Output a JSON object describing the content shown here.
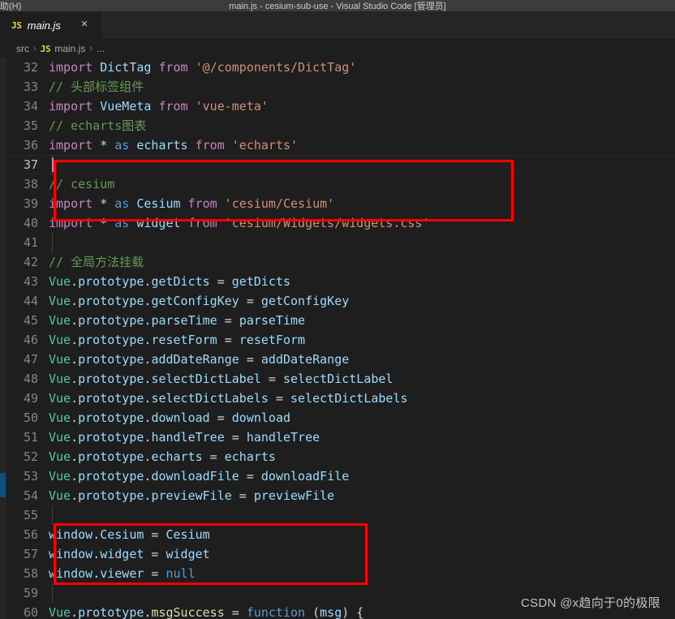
{
  "titlebar": {
    "menu_fragment": "助(H)",
    "window_title": "main.js - cesium-sub-use - Visual Studio Code [管理员]"
  },
  "tab": {
    "file_type_badge": "JS",
    "label": "main.js",
    "close_icon": "×"
  },
  "breadcrumb": {
    "folder": "src",
    "sep1": "›",
    "file_badge": "JS",
    "file": "main.js",
    "sep2": "›",
    "more": "..."
  },
  "editor": {
    "active_line": 37,
    "lines": [
      {
        "n": "32",
        "tokens": [
          {
            "t": "kw",
            "s": "import"
          },
          {
            "t": "op",
            "s": " "
          },
          {
            "t": "var",
            "s": "DictTag"
          },
          {
            "t": "op",
            "s": " "
          },
          {
            "t": "kw",
            "s": "from"
          },
          {
            "t": "op",
            "s": " "
          },
          {
            "t": "str",
            "s": "'@/components/DictTag'"
          }
        ]
      },
      {
        "n": "33",
        "tokens": [
          {
            "t": "cmt",
            "s": "// 头部标签组件"
          }
        ]
      },
      {
        "n": "34",
        "tokens": [
          {
            "t": "kw",
            "s": "import"
          },
          {
            "t": "op",
            "s": " "
          },
          {
            "t": "var",
            "s": "VueMeta"
          },
          {
            "t": "op",
            "s": " "
          },
          {
            "t": "kw",
            "s": "from"
          },
          {
            "t": "op",
            "s": " "
          },
          {
            "t": "str",
            "s": "'vue-meta'"
          }
        ]
      },
      {
        "n": "35",
        "tokens": [
          {
            "t": "cmt",
            "s": "// echarts图表"
          }
        ]
      },
      {
        "n": "36",
        "tokens": [
          {
            "t": "kw",
            "s": "import"
          },
          {
            "t": "op",
            "s": " "
          },
          {
            "t": "op",
            "s": "*"
          },
          {
            "t": "op",
            "s": " "
          },
          {
            "t": "ctrl",
            "s": "as"
          },
          {
            "t": "op",
            "s": " "
          },
          {
            "t": "var",
            "s": "echarts"
          },
          {
            "t": "op",
            "s": " "
          },
          {
            "t": "kw",
            "s": "from"
          },
          {
            "t": "op",
            "s": " "
          },
          {
            "t": "str",
            "s": "'echarts'"
          }
        ]
      },
      {
        "n": "37",
        "tokens": []
      },
      {
        "n": "38",
        "tokens": [
          {
            "t": "cmt",
            "s": "// cesium"
          }
        ]
      },
      {
        "n": "39",
        "tokens": [
          {
            "t": "kw",
            "s": "import"
          },
          {
            "t": "op",
            "s": " "
          },
          {
            "t": "op",
            "s": "*"
          },
          {
            "t": "op",
            "s": " "
          },
          {
            "t": "ctrl",
            "s": "as"
          },
          {
            "t": "op",
            "s": " "
          },
          {
            "t": "var",
            "s": "Cesium"
          },
          {
            "t": "op",
            "s": " "
          },
          {
            "t": "kw",
            "s": "from"
          },
          {
            "t": "op",
            "s": " "
          },
          {
            "t": "str",
            "s": "'cesium/Cesium'"
          }
        ]
      },
      {
        "n": "40",
        "tokens": [
          {
            "t": "kw",
            "s": "import"
          },
          {
            "t": "op",
            "s": " "
          },
          {
            "t": "op",
            "s": "*"
          },
          {
            "t": "op",
            "s": " "
          },
          {
            "t": "ctrl",
            "s": "as"
          },
          {
            "t": "op",
            "s": " "
          },
          {
            "t": "var",
            "s": "widget"
          },
          {
            "t": "op",
            "s": " "
          },
          {
            "t": "kw",
            "s": "from"
          },
          {
            "t": "op",
            "s": " "
          },
          {
            "t": "str",
            "s": "'cesium/Widgets/widgets.css'"
          }
        ]
      },
      {
        "n": "41",
        "tokens": []
      },
      {
        "n": "42",
        "tokens": [
          {
            "t": "cmt",
            "s": "// 全局方法挂载"
          }
        ]
      },
      {
        "n": "43",
        "tokens": [
          {
            "t": "type",
            "s": "Vue"
          },
          {
            "t": "punc",
            "s": "."
          },
          {
            "t": "var",
            "s": "prototype"
          },
          {
            "t": "punc",
            "s": "."
          },
          {
            "t": "var",
            "s": "getDicts"
          },
          {
            "t": "op",
            "s": " = "
          },
          {
            "t": "var",
            "s": "getDicts"
          }
        ]
      },
      {
        "n": "44",
        "tokens": [
          {
            "t": "type",
            "s": "Vue"
          },
          {
            "t": "punc",
            "s": "."
          },
          {
            "t": "var",
            "s": "prototype"
          },
          {
            "t": "punc",
            "s": "."
          },
          {
            "t": "var",
            "s": "getConfigKey"
          },
          {
            "t": "op",
            "s": " = "
          },
          {
            "t": "var",
            "s": "getConfigKey"
          }
        ]
      },
      {
        "n": "45",
        "tokens": [
          {
            "t": "type",
            "s": "Vue"
          },
          {
            "t": "punc",
            "s": "."
          },
          {
            "t": "var",
            "s": "prototype"
          },
          {
            "t": "punc",
            "s": "."
          },
          {
            "t": "var",
            "s": "parseTime"
          },
          {
            "t": "op",
            "s": " = "
          },
          {
            "t": "var",
            "s": "parseTime"
          }
        ]
      },
      {
        "n": "46",
        "tokens": [
          {
            "t": "type",
            "s": "Vue"
          },
          {
            "t": "punc",
            "s": "."
          },
          {
            "t": "var",
            "s": "prototype"
          },
          {
            "t": "punc",
            "s": "."
          },
          {
            "t": "var",
            "s": "resetForm"
          },
          {
            "t": "op",
            "s": " = "
          },
          {
            "t": "var",
            "s": "resetForm"
          }
        ]
      },
      {
        "n": "47",
        "tokens": [
          {
            "t": "type",
            "s": "Vue"
          },
          {
            "t": "punc",
            "s": "."
          },
          {
            "t": "var",
            "s": "prototype"
          },
          {
            "t": "punc",
            "s": "."
          },
          {
            "t": "var",
            "s": "addDateRange"
          },
          {
            "t": "op",
            "s": " = "
          },
          {
            "t": "var",
            "s": "addDateRange"
          }
        ]
      },
      {
        "n": "48",
        "tokens": [
          {
            "t": "type",
            "s": "Vue"
          },
          {
            "t": "punc",
            "s": "."
          },
          {
            "t": "var",
            "s": "prototype"
          },
          {
            "t": "punc",
            "s": "."
          },
          {
            "t": "var",
            "s": "selectDictLabel"
          },
          {
            "t": "op",
            "s": " = "
          },
          {
            "t": "var",
            "s": "selectDictLabel"
          }
        ]
      },
      {
        "n": "49",
        "tokens": [
          {
            "t": "type",
            "s": "Vue"
          },
          {
            "t": "punc",
            "s": "."
          },
          {
            "t": "var",
            "s": "prototype"
          },
          {
            "t": "punc",
            "s": "."
          },
          {
            "t": "var",
            "s": "selectDictLabels"
          },
          {
            "t": "op",
            "s": " = "
          },
          {
            "t": "var",
            "s": "selectDictLabels"
          }
        ]
      },
      {
        "n": "50",
        "tokens": [
          {
            "t": "type",
            "s": "Vue"
          },
          {
            "t": "punc",
            "s": "."
          },
          {
            "t": "var",
            "s": "prototype"
          },
          {
            "t": "punc",
            "s": "."
          },
          {
            "t": "var",
            "s": "download"
          },
          {
            "t": "op",
            "s": " = "
          },
          {
            "t": "var",
            "s": "download"
          }
        ]
      },
      {
        "n": "51",
        "tokens": [
          {
            "t": "type",
            "s": "Vue"
          },
          {
            "t": "punc",
            "s": "."
          },
          {
            "t": "var",
            "s": "prototype"
          },
          {
            "t": "punc",
            "s": "."
          },
          {
            "t": "var",
            "s": "handleTree"
          },
          {
            "t": "op",
            "s": " = "
          },
          {
            "t": "var",
            "s": "handleTree"
          }
        ]
      },
      {
        "n": "52",
        "tokens": [
          {
            "t": "type",
            "s": "Vue"
          },
          {
            "t": "punc",
            "s": "."
          },
          {
            "t": "var",
            "s": "prototype"
          },
          {
            "t": "punc",
            "s": "."
          },
          {
            "t": "var",
            "s": "echarts"
          },
          {
            "t": "op",
            "s": " = "
          },
          {
            "t": "var",
            "s": "echarts"
          }
        ]
      },
      {
        "n": "53",
        "tokens": [
          {
            "t": "type",
            "s": "Vue"
          },
          {
            "t": "punc",
            "s": "."
          },
          {
            "t": "var",
            "s": "prototype"
          },
          {
            "t": "punc",
            "s": "."
          },
          {
            "t": "var",
            "s": "downloadFile"
          },
          {
            "t": "op",
            "s": " = "
          },
          {
            "t": "var",
            "s": "downloadFile"
          }
        ]
      },
      {
        "n": "54",
        "tokens": [
          {
            "t": "type",
            "s": "Vue"
          },
          {
            "t": "punc",
            "s": "."
          },
          {
            "t": "var",
            "s": "prototype"
          },
          {
            "t": "punc",
            "s": "."
          },
          {
            "t": "var",
            "s": "previewFile"
          },
          {
            "t": "op",
            "s": " = "
          },
          {
            "t": "var",
            "s": "previewFile"
          }
        ]
      },
      {
        "n": "55",
        "tokens": []
      },
      {
        "n": "56",
        "tokens": [
          {
            "t": "var",
            "s": "window"
          },
          {
            "t": "punc",
            "s": "."
          },
          {
            "t": "var",
            "s": "Cesium"
          },
          {
            "t": "op",
            "s": " = "
          },
          {
            "t": "var",
            "s": "Cesium"
          }
        ]
      },
      {
        "n": "57",
        "tokens": [
          {
            "t": "var",
            "s": "window"
          },
          {
            "t": "punc",
            "s": "."
          },
          {
            "t": "var",
            "s": "widget"
          },
          {
            "t": "op",
            "s": " = "
          },
          {
            "t": "var",
            "s": "widget"
          }
        ]
      },
      {
        "n": "58",
        "tokens": [
          {
            "t": "var",
            "s": "window"
          },
          {
            "t": "punc",
            "s": "."
          },
          {
            "t": "var",
            "s": "viewer"
          },
          {
            "t": "op",
            "s": " = "
          },
          {
            "t": "ctrl",
            "s": "null"
          }
        ]
      },
      {
        "n": "59",
        "tokens": []
      },
      {
        "n": "60",
        "tokens": [
          {
            "t": "type",
            "s": "Vue"
          },
          {
            "t": "punc",
            "s": "."
          },
          {
            "t": "var",
            "s": "prototype"
          },
          {
            "t": "punc",
            "s": "."
          },
          {
            "t": "fn",
            "s": "msgSuccess"
          },
          {
            "t": "op",
            "s": " = "
          },
          {
            "t": "ctrl",
            "s": "function"
          },
          {
            "t": "op",
            "s": " ("
          },
          {
            "t": "var",
            "s": "msg"
          },
          {
            "t": "op",
            "s": ") {"
          }
        ]
      }
    ]
  },
  "annotations": {
    "box1": {
      "label": "cesium-import-highlight"
    },
    "box2": {
      "label": "window-globals-highlight"
    },
    "accent_red": "#ff0000",
    "accent_blue": "#0e4f7c"
  },
  "watermark": {
    "text": "CSDN @x趋向于0的极限"
  }
}
